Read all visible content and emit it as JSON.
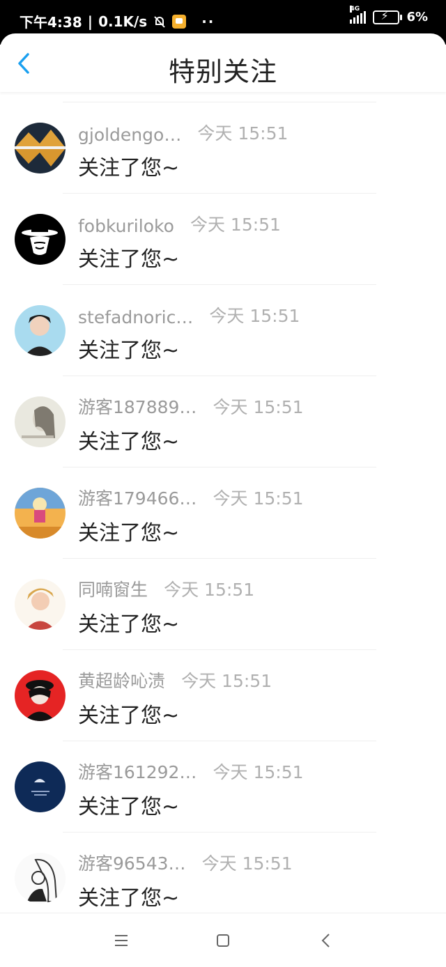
{
  "status_bar": {
    "time": "下午4:38",
    "separator": "|",
    "speed": "0.1K/s",
    "dots": "··",
    "network": "4G",
    "battery": "6%",
    "icons": [
      "mute-bell-icon",
      "app-notification-icon",
      "signal-icon",
      "battery-charging-icon"
    ]
  },
  "header": {
    "title": "特别关注",
    "back_icon": "chevron-left-icon",
    "accent_color": "#1aa0f0"
  },
  "list": {
    "items": [
      {
        "username": "gjoldengo…",
        "time": "今天 15:51",
        "message": "关注了您~",
        "avatar": "landscape-reflection"
      },
      {
        "username": "fobkuriloko",
        "time": "今天 15:51",
        "message": "关注了您~",
        "avatar": "masked-figure"
      },
      {
        "username": "stefadnoric…",
        "time": "今天 15:51",
        "message": "关注了您~",
        "avatar": "person-portrait"
      },
      {
        "username": "游客187889…",
        "time": "今天 15:51",
        "message": "关注了您~",
        "avatar": "woman-sketch"
      },
      {
        "username": "游客179466…",
        "time": "今天 15:51",
        "message": "关注了您~",
        "avatar": "cartoon-sunset"
      },
      {
        "username": "同喃窗生",
        "time": "今天 15:51",
        "message": "关注了您~",
        "avatar": "person-portrait"
      },
      {
        "username": "黄超龄吣渍",
        "time": "今天 15:51",
        "message": "关注了您~",
        "avatar": "anime-red"
      },
      {
        "username": "游客161292…",
        "time": "今天 15:51",
        "message": "关注了您~",
        "avatar": "navy-logo"
      },
      {
        "username": "游客96543…",
        "time": "今天 15:51",
        "message": "关注了您~",
        "avatar": "manga-sketch"
      }
    ]
  },
  "nav_bar": {
    "icons": [
      "menu-icon",
      "home-square-icon",
      "back-chevron-icon"
    ]
  }
}
